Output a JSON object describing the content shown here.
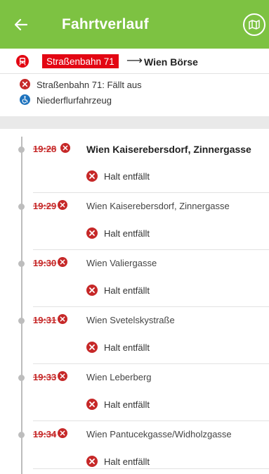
{
  "appbar": {
    "title": "Fahrtverlauf",
    "back_icon": "arrow-left-icon",
    "map_icon": "map-icon",
    "color": "#7dc242"
  },
  "route": {
    "line": "Straßenbahn 71",
    "arrow": "⟶",
    "destination": "Wien Börse",
    "line_color": "#e30613"
  },
  "notices": [
    {
      "icon": "cancel-circle-icon",
      "text": "Straßenbahn 71: Fällt aus"
    },
    {
      "icon": "wheelchair-icon",
      "text": "Niederflurfahrzeug"
    }
  ],
  "stops": [
    {
      "time": "19:28",
      "name": "Wien Kaiserebersdorf, Zinnergasse",
      "status": "Halt entfällt"
    },
    {
      "time": "19:29",
      "name": "Wien Kaiserebersdorf, Zinnergasse",
      "status": "Halt entfällt"
    },
    {
      "time": "19:30",
      "name": "Wien Valiergasse",
      "status": "Halt entfällt"
    },
    {
      "time": "19:31",
      "name": "Wien Svetelskystraße",
      "status": "Halt entfällt"
    },
    {
      "time": "19:33",
      "name": "Wien Leberberg",
      "status": "Halt entfällt"
    },
    {
      "time": "19:34",
      "name": "Wien Pantucekgasse/Widholzgasse",
      "status": "Halt entfällt"
    }
  ]
}
